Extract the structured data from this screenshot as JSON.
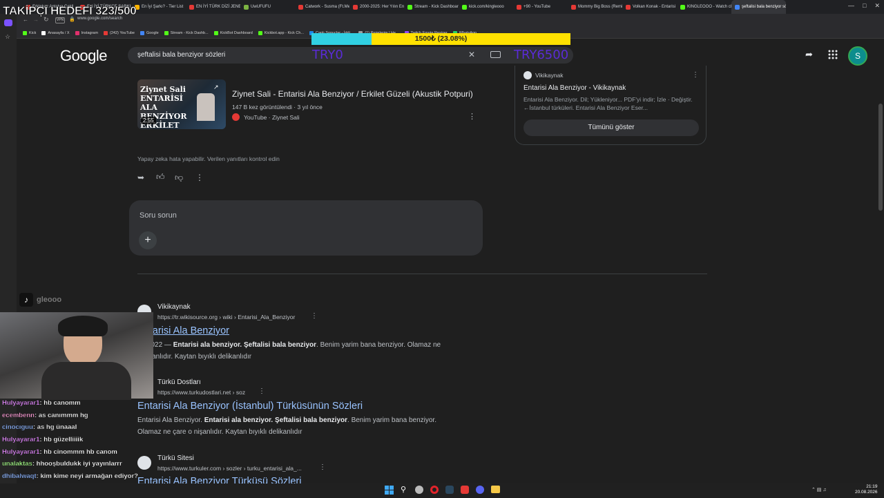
{
  "browser": {
    "tabs": [
      {
        "label": "Erkinkaz Antalya Çekil",
        "color": "#e53935"
      },
      {
        "label": "EN İYİ TÜRKÇE ŞARKI",
        "color": "#e53935"
      },
      {
        "label": "En İyi Şarkı? - Tier List",
        "color": "#ffb300"
      },
      {
        "label": "EN İYİ TÜRK DİZİ JENERİ",
        "color": "#e53935"
      },
      {
        "label": "UwUFUFU",
        "color": "#7cb342"
      },
      {
        "label": "Catwork - Susma (Ft.Mel",
        "color": "#e53935"
      },
      {
        "label": "2000-2025: Her Yılın En",
        "color": "#e53935"
      },
      {
        "label": "Stream - Kick Dashboard",
        "color": "#53fc18"
      },
      {
        "label": "kick.com/kingleooo",
        "color": "#53fc18"
      },
      {
        "label": "+90 - YouTube",
        "color": "#e53935"
      },
      {
        "label": "Mommy Big Boss (Remix",
        "color": "#e53935"
      },
      {
        "label": "Volkan Konak - Entarisi",
        "color": "#e53935"
      },
      {
        "label": "KINGLEOOO - Watch clip",
        "color": "#53fc18"
      },
      {
        "label": "şeftalisi bala benziyor sözl",
        "color": "#4285f4"
      }
    ],
    "active_tab_index": 13,
    "url": "www.google.com/search",
    "bookmarks": [
      {
        "label": "Kick",
        "color": "#53fc18"
      },
      {
        "label": "Anasayfa / X",
        "color": "#ffffff"
      },
      {
        "label": "Instagram",
        "color": "#e1306c"
      },
      {
        "label": "(242) YouTube",
        "color": "#e53935"
      },
      {
        "label": "Google",
        "color": "#4285f4"
      },
      {
        "label": "Stream - Kick Dashb...",
        "color": "#53fc18"
      },
      {
        "label": "KickBot Dashboard",
        "color": "#53fc18"
      },
      {
        "label": "Kickbot.app - Kick Ch...",
        "color": "#53fc18"
      },
      {
        "label": "Canlı Sonuçlar - İddi...",
        "color": "#1e88e5"
      },
      {
        "label": "(1) Projelerim | He...",
        "color": "#9e9e9e"
      },
      {
        "label": "Twitch Emote Resizer",
        "color": "#9146ff"
      },
      {
        "label": "WhatsApp",
        "color": "#25d366"
      }
    ]
  },
  "google": {
    "logo": "Google",
    "query": "şeftalisi bala benziyor sözleri",
    "avatar_letter": "S"
  },
  "video": {
    "title": "Ziynet Sali - Entarisi Ala Benziyor / Erkilet Güzeli (Akustik Potpuri)",
    "meta": "147 B kez görüntülendi · 3 yıl önce",
    "source": "YouTube · Ziynet Sali",
    "duration": "2:55",
    "thumb_text": "Ziynet Sali ENTARİSİ ALA BENZİYOR ERKİLET GÜZELİ"
  },
  "ai_disclaimer": "Yapay zeka hata yapabilir. Verilen yanıtları kontrol edin",
  "ask_placeholder": "Soru sorun",
  "side_card": {
    "source": "Vikikaynak",
    "title": "Entarisi Ala Benziyor - Vikikaynak",
    "snippet": "Entarisi Ala Benziyor. Dil; Yükleniyor... PDF'yi indir; İzle · Değiştir. ←İstanbul türküleri. Entarisi Ala Benziyor Eser...",
    "button": "Tümünü göster"
  },
  "results": [
    {
      "site": "Vikikaynak",
      "url": "https://tr.wikisource.org › wiki › Entarisi_Ala_Benziyor",
      "title": "Entarisi Ala Benziyor",
      "date": "ğu 2022 — ",
      "snippet_bold": "Entarisi ala benziyor. Şeftalisi bala benziyor",
      "snippet_rest": ". Benim yarim bana benziyor. Olamaz ne",
      "snippet_line2": "o nişanlıdır. Kaytan bıyıklı delikanlıdır"
    },
    {
      "site": "Türkü Dostları",
      "url": "https://www.turkudostlari.net › soz",
      "title": "Entarisi Ala Benziyor (İstanbul) Türküsünün Sözleri",
      "snippet_start": "Entarisi Ala Benziyor. ",
      "snippet_bold": "Entarisi ala benziyor. Şeftalisi bala benziyor",
      "snippet_rest": ". Benim yarim bana benziyor.",
      "snippet_line2": "Olamaz ne çare o nişanlıdır. Kaytan bıyıklı delikanlıdır"
    },
    {
      "site": "Türkü Sitesi",
      "url": "https://www.turkuler.com › sozler › turku_entarisi_ala_...",
      "title": "Entarisi Ala Benziyor Türküsü Sözleri"
    }
  ],
  "stream": {
    "goal_text": "TAKİPÇİ HEDEFİ 323/500",
    "donation_label": "1500₺ (23.08%)",
    "donation_progress": 0.2308,
    "try_left": "TRY0",
    "try_right": "TRY6500",
    "tiktok_handle": "gleooo",
    "chat": [
      {
        "user": "Hulyayarar1",
        "msg": "hb canomm",
        "color": "#e58bff"
      },
      {
        "user": "ecembenn",
        "msg": "as canımmm hg",
        "color": "#ff9fd8"
      },
      {
        "user": "cinocıguu",
        "msg": "as hg ünaaal",
        "color": "#8fb6ff"
      },
      {
        "user": "Hulyayarar1",
        "msg": "hb güzelliiiik",
        "color": "#e58bff"
      },
      {
        "user": "Hulyayarar1",
        "msg": "hb cinommm hb canom",
        "color": "#e58bff"
      },
      {
        "user": "unalaktas",
        "msg": "hhooşbuldukk iyi yayınlarrr",
        "color": "#a7ff8a"
      },
      {
        "user": "dhibalwaqt",
        "msg": "kim kime neyi armağan ediyor?",
        "color": "#8fb6ff"
      },
      {
        "user": "cinocıguu",
        "msg": "🔊 🎺",
        "color": "#8fb6ff"
      }
    ]
  },
  "taskbar": {
    "time": "21:19",
    "date": "20.08.2026"
  }
}
